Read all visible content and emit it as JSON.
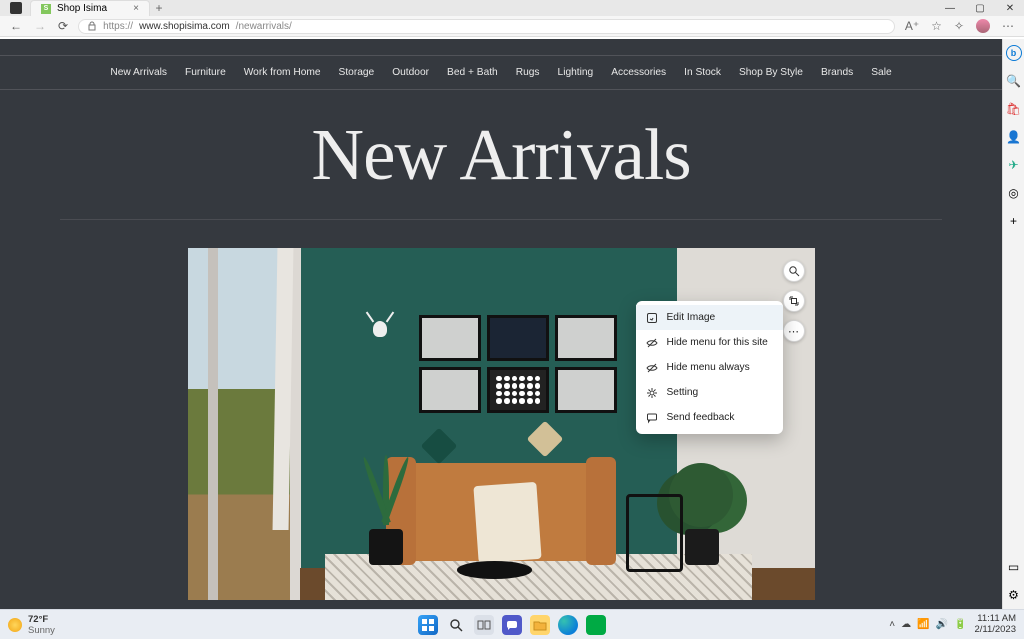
{
  "browser": {
    "tab_title": "Shop Isima",
    "new_tab": "+",
    "win": {
      "min": "—",
      "max": "▢",
      "close": "✕"
    },
    "nav": {
      "back": "←",
      "forward": "→",
      "refresh": "⟳"
    },
    "url_scheme": "https://",
    "url_host": "www.shopisima.com",
    "url_path": "/newarrivals/",
    "addr_icons": {
      "read": "A⁺",
      "fav": "☆",
      "collections": "✧",
      "ext": "⊞",
      "more": "⋯"
    }
  },
  "edge_sidebar": {
    "bing": "b",
    "search": "🔍",
    "shopping": "🛍",
    "games": "🎮",
    "tools": "👤",
    "drop": "✈",
    "m365": "◎",
    "add": "+",
    "bottom1": "▭",
    "bottom2": "⚙"
  },
  "page": {
    "nav": [
      "New Arrivals",
      "Furniture",
      "Work from Home",
      "Storage",
      "Outdoor",
      "Bed + Bath",
      "Rugs",
      "Lighting",
      "Accessories",
      "In Stock",
      "Shop By Style",
      "Brands",
      "Sale"
    ],
    "hero_title": "New Arrivals"
  },
  "image_hover": {
    "visual_search": "vs",
    "smart_crop": "sc",
    "more": "⋯"
  },
  "context_menu": {
    "items": [
      {
        "icon": "edit",
        "label": "Edit Image"
      },
      {
        "icon": "hide",
        "label": "Hide menu for this site"
      },
      {
        "icon": "hide-always",
        "label": "Hide menu always"
      },
      {
        "icon": "settings",
        "label": "Setting"
      },
      {
        "icon": "feedback",
        "label": "Send feedback"
      }
    ]
  },
  "taskbar": {
    "weather_temp": "72°F",
    "weather_cond": "Sunny",
    "tray": {
      "chevron": "˄",
      "cloud": "☁",
      "wifi": "📶",
      "vol": "🔊",
      "batt": "🔋"
    },
    "time": "11:11 AM",
    "date": "2/11/2023"
  }
}
